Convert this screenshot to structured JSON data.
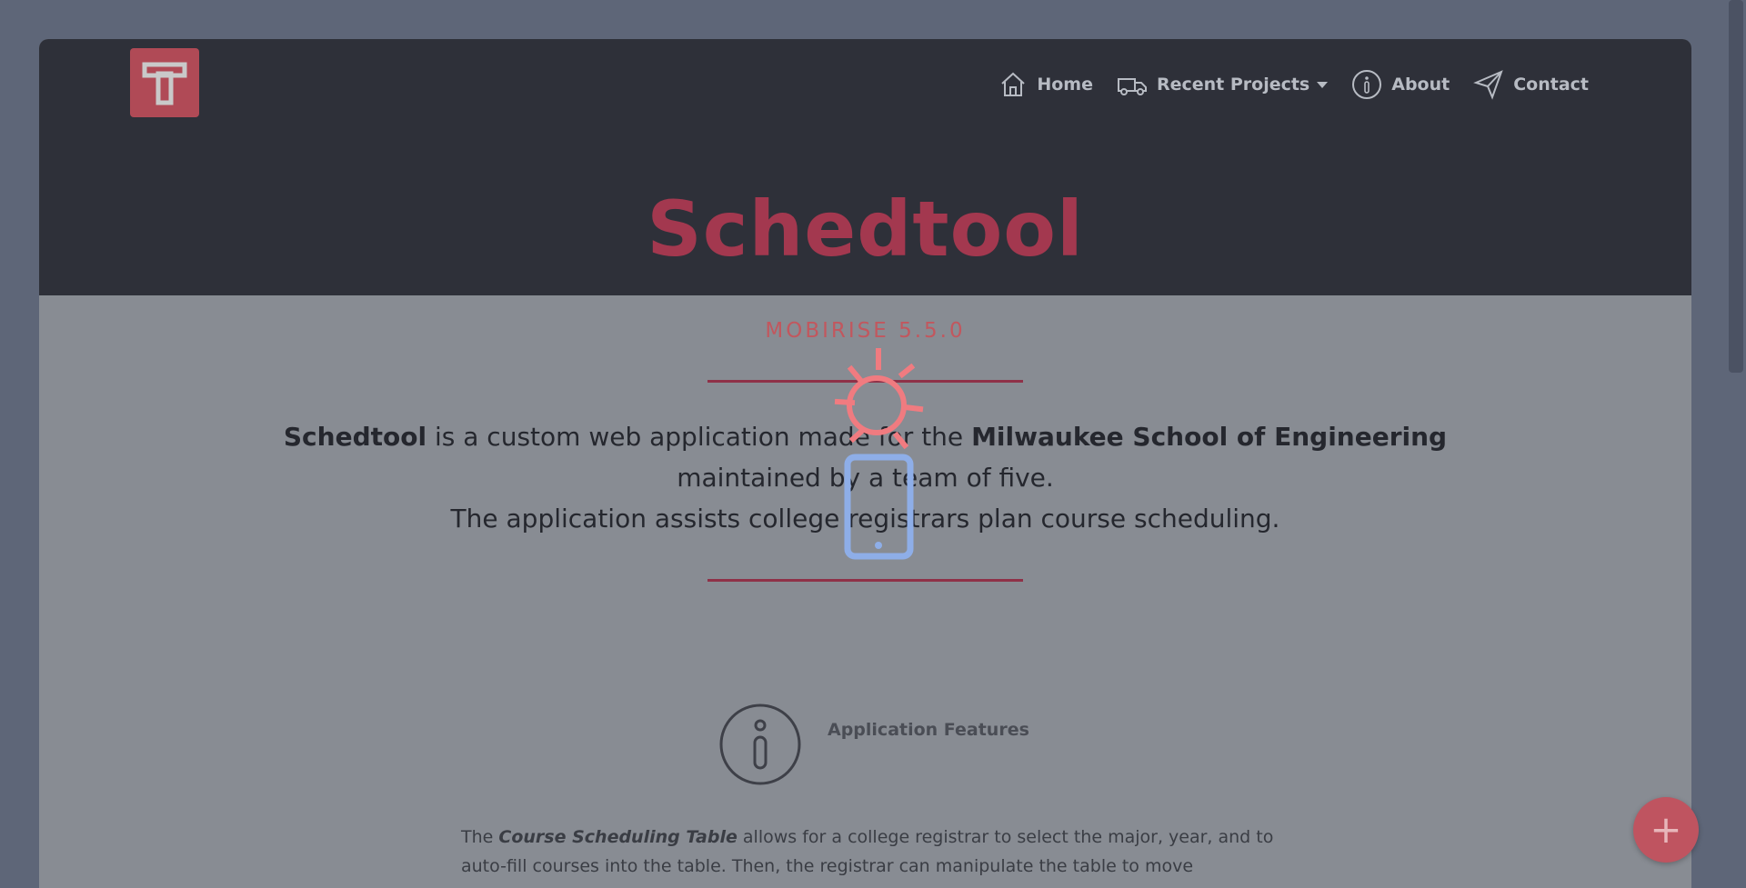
{
  "nav": {
    "items": [
      {
        "label": "Home",
        "icon": "home-icon"
      },
      {
        "label": "Recent Projects",
        "icon": "truck-icon"
      },
      {
        "label": "About",
        "icon": "info-icon"
      },
      {
        "label": "Contact",
        "icon": "send-icon"
      }
    ]
  },
  "logo": {
    "letter": "T"
  },
  "hero": {
    "title": "Schedtool",
    "subtitle": "MOBIRISE 5.5.0"
  },
  "intro": {
    "b1": "Schedtool",
    "t1": " is a custom web application made for the ",
    "b2": "Milwaukee School of Engineering",
    "line2": "maintained by a team of five.",
    "line3": "The application assists college registrars plan course scheduling."
  },
  "features": {
    "title": "Application Features",
    "t1": "The ",
    "emph": "Course Scheduling Table",
    "t2": " allows for a college registrar to select the major, year, and to auto-fill courses into the table. Then, the registrar can manipulate the table to move conflicting"
  },
  "fab": {
    "symbol": "+"
  },
  "colors": {
    "accent": "#a3384f",
    "header_bg": "#2e3039",
    "body_bg": "#888c93"
  }
}
